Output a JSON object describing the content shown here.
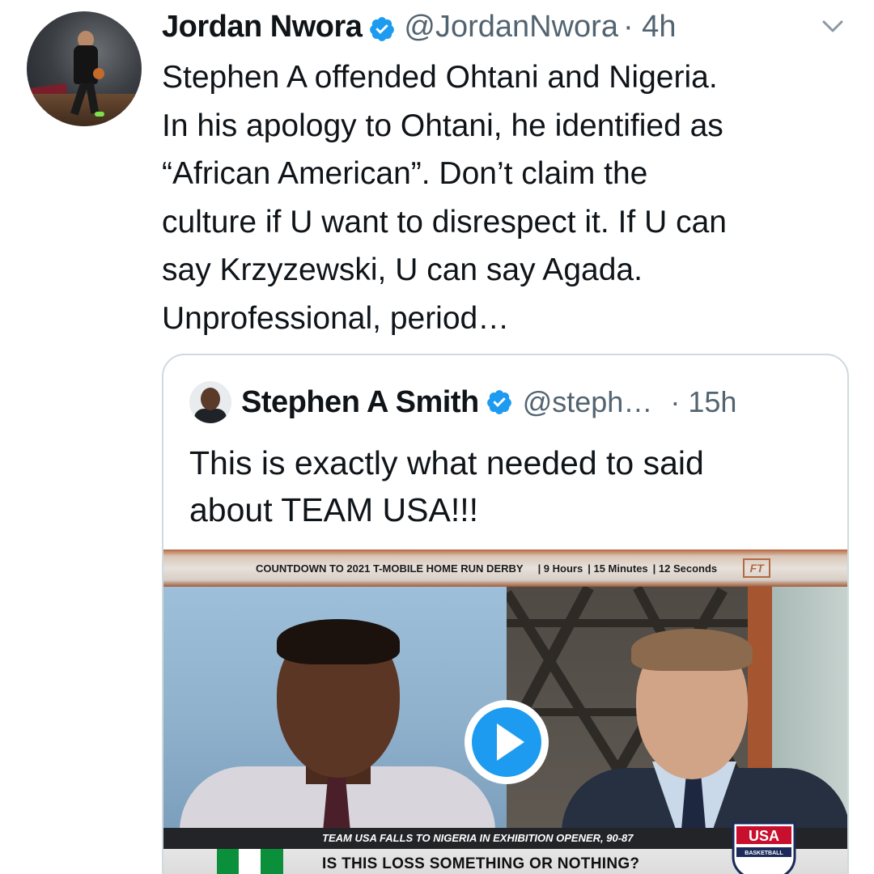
{
  "tweet": {
    "author_name": "Jordan Nwora",
    "author_handle": "@JordanNwora",
    "time": "· 4h",
    "text_lines": [
      "Stephen A offended Ohtani and Nigeria.",
      "In his apology to Ohtani, he identified as",
      "“African American”. Don’t claim the",
      "culture if U want to disrespect it. If U can",
      "say Krzyzewski, U can say Agada.",
      "Unprofessional, period…"
    ]
  },
  "quoted_tweet": {
    "author_name": "Stephen A Smith",
    "author_handle": "@steph…",
    "time": "· 15h",
    "text_lines": [
      "This is exactly what needed to said",
      "about TEAM USA!!!"
    ],
    "media": {
      "ticker_countdown": "COUNTDOWN TO 2021 T-MOBILE HOME RUN DERBY",
      "ticker_hours": "| 9 Hours",
      "ticker_minutes": "| 15 Minutes",
      "ticker_seconds": "| 12 Seconds",
      "ticker_logo": "FT",
      "lower_third_top": "TEAM USA FALLS TO NIGERIA IN EXHIBITION OPENER, 90-87",
      "lower_third_headline": "IS THIS LOSS SOMETHING OR NOTHING?",
      "usa_logo_text": "USA",
      "usa_logo_subtext": "BASKETBALL"
    }
  },
  "colors": {
    "verified_blue": "#1d9bf0",
    "text_primary": "#0f1419",
    "text_secondary": "#536471",
    "border": "#cfd9de"
  },
  "icons": {
    "verified": "verified-badge-icon",
    "more": "chevron-down-icon",
    "play": "play-icon"
  }
}
